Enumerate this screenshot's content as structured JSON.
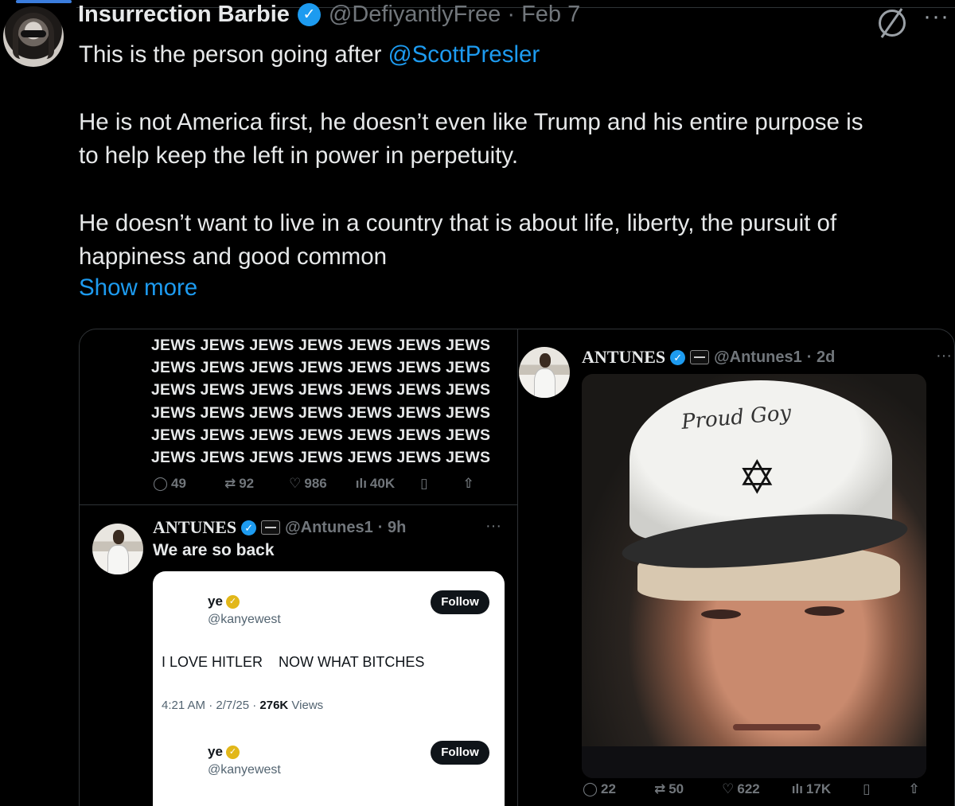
{
  "tweet": {
    "author_name": "Insurrection Barbie",
    "handle": "@DefiyantlyFree",
    "date": "· Feb 7",
    "text_line1_prefix": "This is the person going after ",
    "mention": "@ScottPresler",
    "para2_line1": "He is not America first, he doesn’t even like Trump and his entire purpose is",
    "para2_line2": "to help keep the left in power in perpetuity.",
    "para3_line1": "He doesn’t want to live in a country that is about life, liberty, the pursuit of",
    "para3_line2": "happiness and good common",
    "show_more": "Show more"
  },
  "left_post": {
    "repeated_lines": [
      "JEWS JEWS JEWS JEWS JEWS JEWS JEWS",
      "JEWS JEWS JEWS JEWS JEWS JEWS JEWS",
      "JEWS JEWS JEWS JEWS JEWS JEWS JEWS",
      "JEWS JEWS JEWS JEWS JEWS JEWS JEWS",
      "JEWS JEWS JEWS JEWS JEWS JEWS JEWS",
      "JEWS JEWS JEWS JEWS JEWS JEWS JEWS"
    ],
    "replies": "49",
    "reposts": "92",
    "likes": "986",
    "views": "40K"
  },
  "quote_post": {
    "author": "ANTUNES",
    "handle": "@Antunes1",
    "time": "· 9h",
    "text": "We are so back",
    "card": {
      "name": "ye",
      "handle": "@kanyewest",
      "follow_label": "Follow",
      "tweet_text": "I LOVE HITLER    NOW WHAT BITCHES",
      "meta_time": "4:21 AM · 2/7/25 · ",
      "meta_views_count": "276K",
      "meta_views_label": " Views",
      "name2": "ye",
      "handle2": "@kanyewest",
      "follow_label2": "Follow"
    }
  },
  "right_post": {
    "author": "ANTUNES",
    "handle": "@Antunes1",
    "time": "· 2d",
    "hat_text": "Proud Goy",
    "replies": "22",
    "reposts": "50",
    "likes": "622",
    "views": "17K"
  },
  "colors": {
    "accent": "#1d9bf0",
    "background": "#000000",
    "muted": "#71767b"
  }
}
